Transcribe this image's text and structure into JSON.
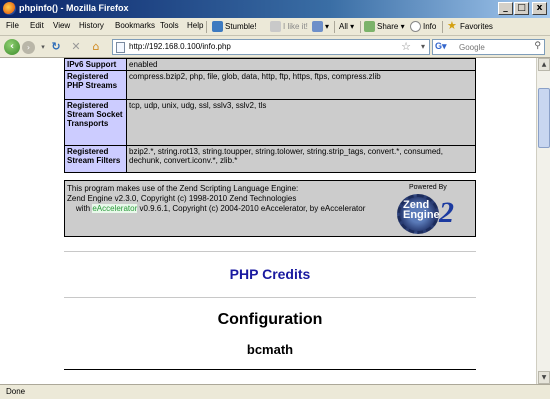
{
  "window": {
    "title": "phpinfo() - Mozilla Firefox",
    "min": "_",
    "max": "□",
    "close": "x"
  },
  "menu": {
    "items": [
      "File",
      "Edit",
      "View",
      "History",
      "Bookmarks",
      "Tools",
      "Help"
    ],
    "stumble": "Stumble!",
    "ilike": "I like it!",
    "all": "All",
    "share": "Share",
    "info": "Info",
    "favorites": "Favorites"
  },
  "nav": {
    "url": "http://192.168.0.100/info.php",
    "search_placeholder": "Google"
  },
  "info_rows": [
    {
      "label": "IPv6 Support",
      "value": "enabled"
    },
    {
      "label": "Registered PHP Streams",
      "value": "compress.bzip2, php, file, glob, data, http, ftp, https, ftps, compress.zlib"
    },
    {
      "label": "Registered Stream Socket Transports",
      "value": "tcp, udp, unix, udg, ssl, sslv3, sslv2, tls"
    },
    {
      "label": "Registered Stream Filters",
      "value": "bzip2.*, string.rot13, string.toupper, string.tolower, string.strip_tags, convert.*, consumed, dechunk, convert.iconv.*, zlib.*"
    }
  ],
  "zend": {
    "line1": "This program makes use of the Zend Scripting Language Engine:",
    "line2": "Zend Engine v2.3.0, Copyright (c) 1998-2010 Zend Technologies",
    "line3_prefix": "with ",
    "line3_link": "eAccelerator",
    "line3_suffix": " v0.9.6.1, Copyright (c) 2004-2010 eAccelerator, by eAccelerator",
    "powered_by": "Powered By",
    "logo_word1": "Zend",
    "logo_word2": "Engine",
    "logo_num": "2"
  },
  "headings": {
    "credits": "PHP Credits",
    "configuration": "Configuration",
    "bcmath": "bcmath"
  },
  "status": {
    "text": "Done"
  }
}
